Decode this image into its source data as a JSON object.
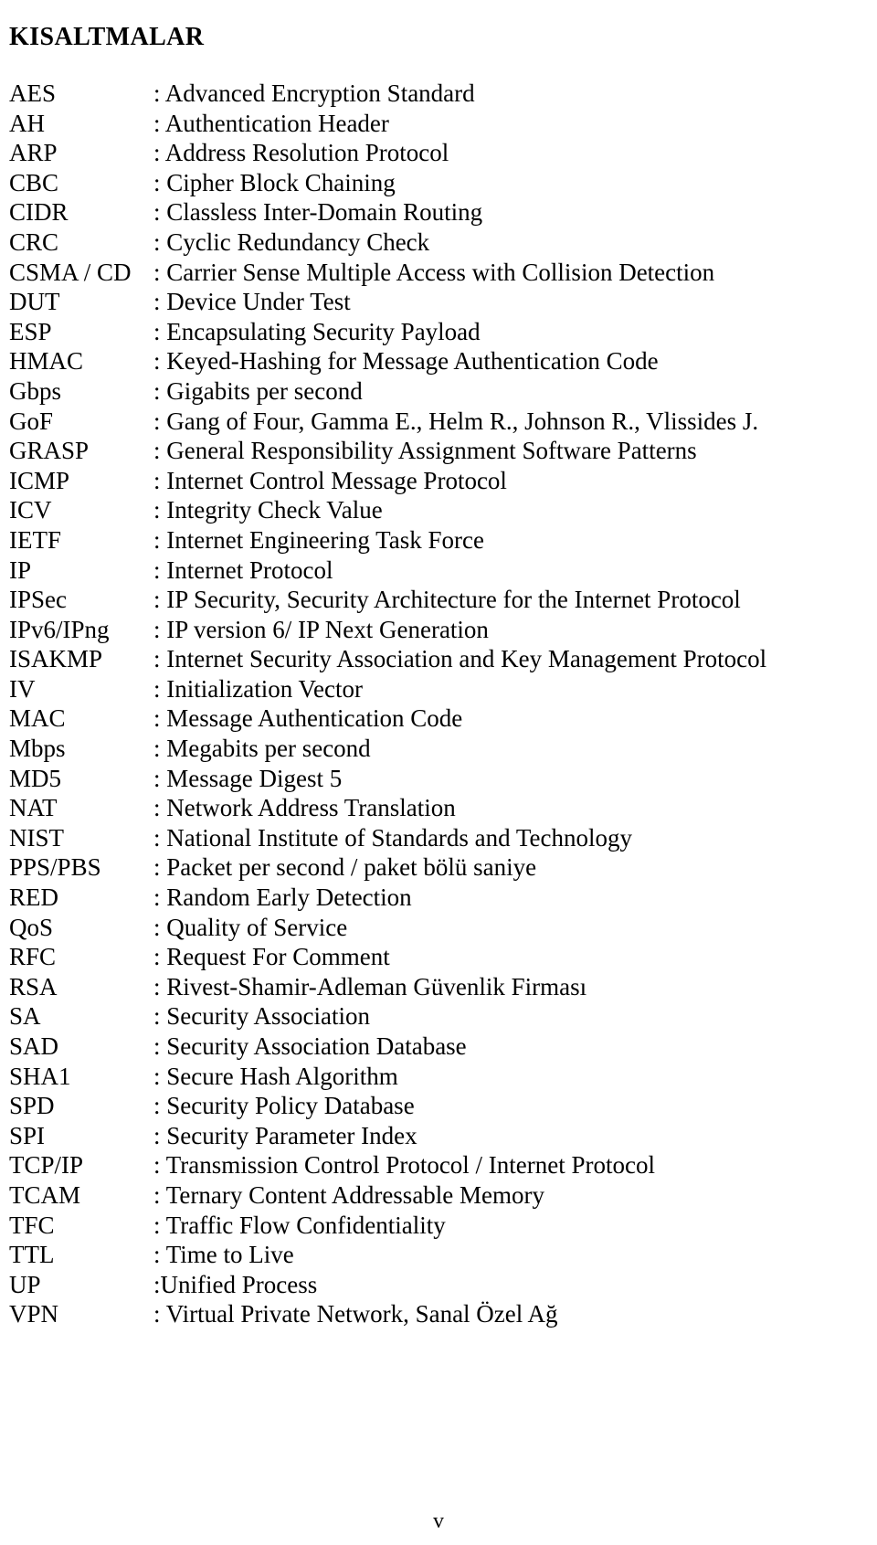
{
  "document": {
    "title": "KISALTMALAR",
    "footer_page_number": "v",
    "text_color": "#000000",
    "background_color": "#ffffff"
  },
  "abbreviations": [
    {
      "term": "AES",
      "definition": ": Advanced Encryption Standard"
    },
    {
      "term": "AH",
      "definition": ": Authentication Header"
    },
    {
      "term": "ARP",
      "definition": ": Address Resolution Protocol"
    },
    {
      "term": "CBC",
      "definition": ": Cipher Block Chaining"
    },
    {
      "term": "CIDR",
      "definition": ": Classless Inter-Domain Routing"
    },
    {
      "term": "CRC",
      "definition": ": Cyclic Redundancy Check"
    },
    {
      "term": "CSMA / CD",
      "definition": ": Carrier Sense Multiple Access with Collision Detection"
    },
    {
      "term": "DUT",
      "definition": ": Device Under Test"
    },
    {
      "term": "ESP",
      "definition": ": Encapsulating Security Payload"
    },
    {
      "term": "HMAC",
      "definition": ": Keyed-Hashing for Message Authentication Code"
    },
    {
      "term": "Gbps",
      "definition": ": Gigabits per second"
    },
    {
      "term": "GoF",
      "definition": ": Gang of Four, Gamma E., Helm R., Johnson R., Vlissides J."
    },
    {
      "term": "GRASP",
      "definition": ": General Responsibility Assignment Software Patterns"
    },
    {
      "term": "ICMP",
      "definition": ": Internet Control Message Protocol"
    },
    {
      "term": "ICV",
      "definition": ": Integrity Check Value"
    },
    {
      "term": "IETF",
      "definition": ": Internet Engineering Task Force"
    },
    {
      "term": "IP",
      "definition": ": Internet Protocol"
    },
    {
      "term": "IPSec",
      "definition": ": IP Security, Security Architecture for the Internet Protocol"
    },
    {
      "term": "IPv6/IPng",
      "definition": ": IP version 6/ IP Next Generation"
    },
    {
      "term": "ISAKMP",
      "definition": ": Internet Security Association and Key Management Protocol"
    },
    {
      "term": "IV",
      "definition": ": Initialization Vector"
    },
    {
      "term": "MAC",
      "definition": ": Message Authentication Code"
    },
    {
      "term": "Mbps",
      "definition": ": Megabits per second"
    },
    {
      "term": "MD5",
      "definition": ": Message Digest 5"
    },
    {
      "term": "NAT",
      "definition": ": Network Address Translation"
    },
    {
      "term": "NIST",
      "definition": ": National Institute of Standards and Technology"
    },
    {
      "term": "PPS/PBS",
      "definition": ": Packet per second / paket bölü saniye"
    },
    {
      "term": "RED",
      "definition": ": Random Early Detection"
    },
    {
      "term": "QoS",
      "definition": ": Quality of Service"
    },
    {
      "term": "RFC",
      "definition": ": Request For Comment"
    },
    {
      "term": "RSA",
      "definition": ": Rivest-Shamir-Adleman Güvenlik Firması"
    },
    {
      "term": "SA",
      "definition": ": Security Association"
    },
    {
      "term": "SAD",
      "definition": ": Security Association Database"
    },
    {
      "term": "SHA1",
      "definition": ": Secure Hash Algorithm"
    },
    {
      "term": "SPD",
      "definition": ": Security Policy Database"
    },
    {
      "term": "SPI",
      "definition": ": Security Parameter Index"
    },
    {
      "term": "TCP/IP",
      "definition": ": Transmission Control Protocol / Internet Protocol"
    },
    {
      "term": "TCAM",
      "definition": ": Ternary Content Addressable Memory"
    },
    {
      "term": "TFC",
      "definition": ": Traffic Flow Confidentiality"
    },
    {
      "term": "TTL",
      "definition": ": Time to Live"
    },
    {
      "term": "UP",
      "definition": ":Unified Process"
    },
    {
      "term": "VPN",
      "definition": ": Virtual Private Network, Sanal Özel Ağ"
    }
  ]
}
